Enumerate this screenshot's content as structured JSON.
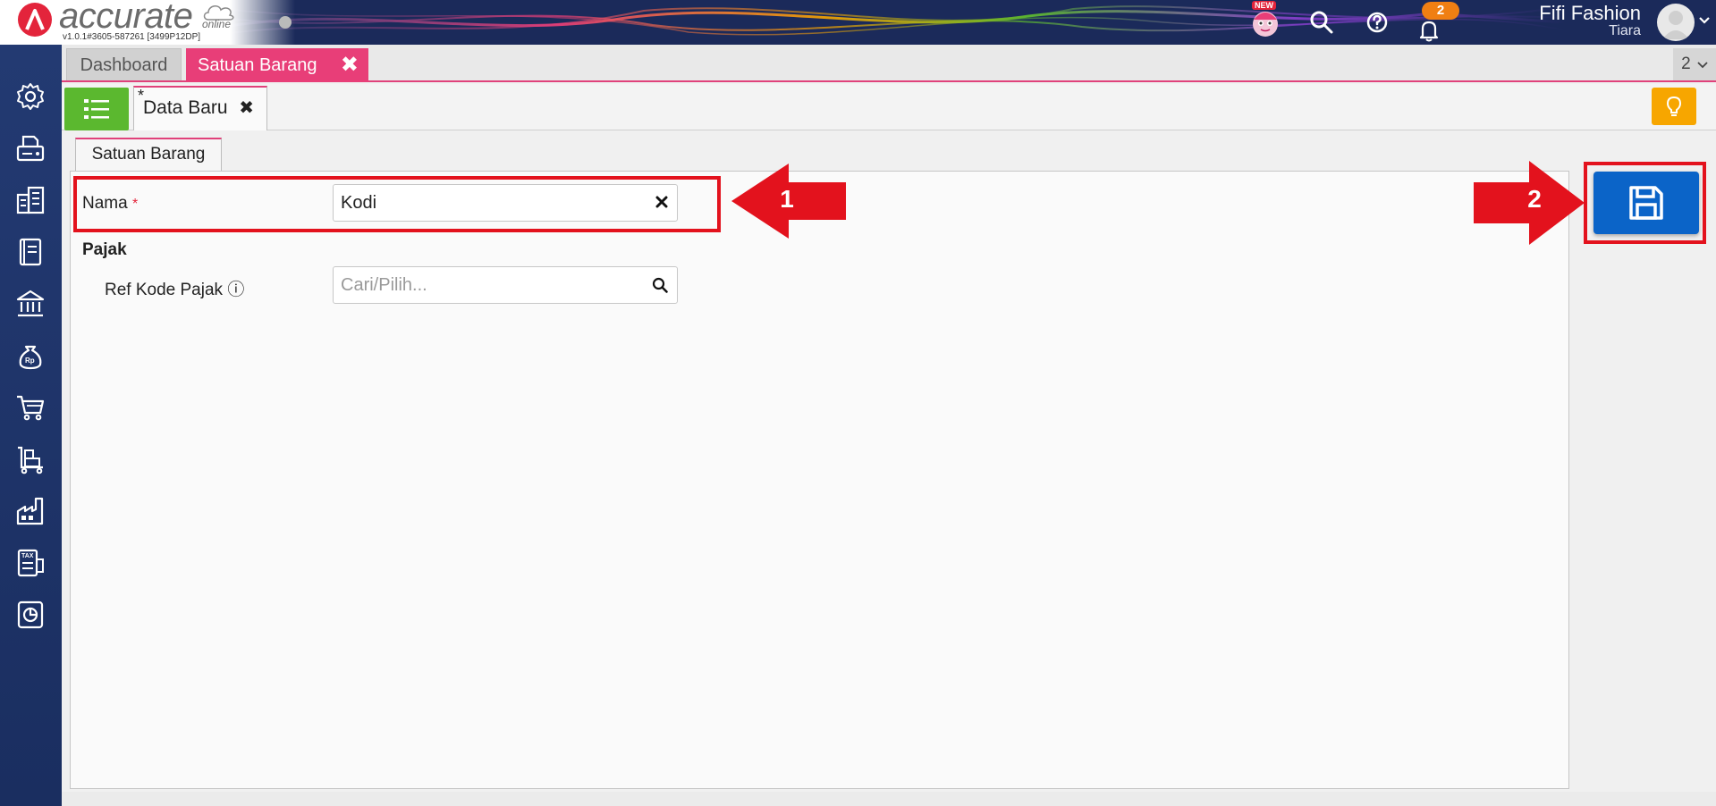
{
  "header": {
    "logo_text": "accurate",
    "logo_sub": "online",
    "version": "v1.0.1#3605-587261 [3499P12DP]",
    "new_badge": "NEW",
    "notification_count": "2",
    "company_name": "Fifi Fashion",
    "user_name": "Tiara"
  },
  "sidebar": {
    "items": [
      {
        "icon": "gear-icon"
      },
      {
        "icon": "fax-icon"
      },
      {
        "icon": "buildings-icon"
      },
      {
        "icon": "ledger-book-icon"
      },
      {
        "icon": "bank-icon"
      },
      {
        "icon": "money-bag-icon"
      },
      {
        "icon": "shopping-cart-icon"
      },
      {
        "icon": "trolley-boxes-icon"
      },
      {
        "icon": "factory-icon"
      },
      {
        "icon": "tax-document-icon"
      },
      {
        "icon": "report-chart-icon"
      }
    ]
  },
  "tabs": {
    "dashboard": "Dashboard",
    "active": "Satuan Barang",
    "close_glyph": "✖",
    "count": "2"
  },
  "toolbar": {
    "subtab_label": "Data Baru",
    "subtab_modified_marker": "*",
    "subtab_close_glyph": "✖"
  },
  "form": {
    "section_tab": "Satuan Barang",
    "nama_label": "Nama",
    "required_marker": "*",
    "nama_value": "Kodi",
    "pajak_title": "Pajak",
    "ref_kode_pajak_label": "Ref Kode Pajak",
    "info_glyph": "ⓘ",
    "ref_kode_pajak_placeholder": "Cari/Pilih..."
  },
  "annotations": {
    "step1": "1",
    "step2": "2",
    "color": "#e3121d"
  },
  "colors": {
    "accent_pink": "#e83e78",
    "list_button_green": "#5bb82f",
    "save_button_blue": "#0b64c8",
    "bulb_button_orange": "#f7a600",
    "sidebar_navy": "#233a72"
  }
}
